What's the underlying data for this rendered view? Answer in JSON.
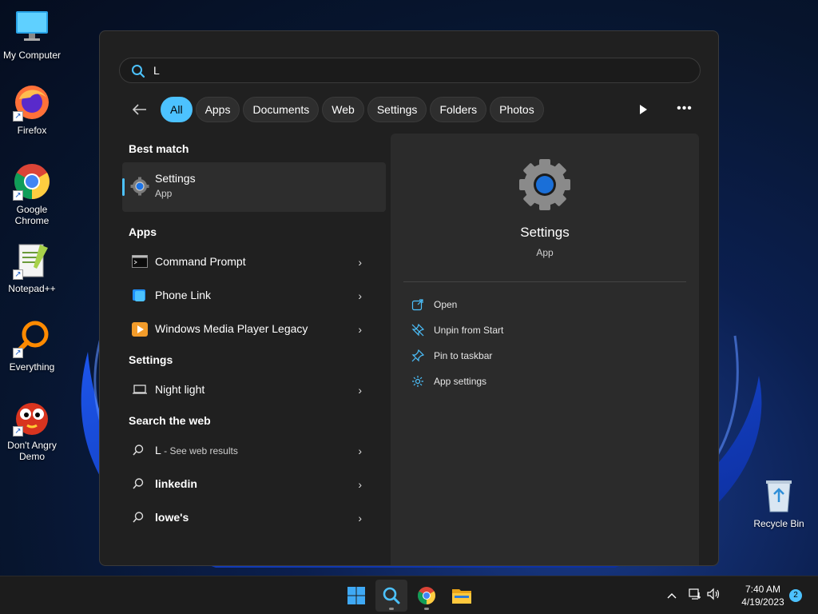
{
  "desktop": {
    "icons": [
      {
        "label": "My Computer",
        "icon": "monitor-icon"
      },
      {
        "label": "Firefox",
        "icon": "firefox-icon"
      },
      {
        "label": "Google Chrome",
        "icon": "chrome-icon"
      },
      {
        "label": "Notepad++",
        "icon": "notepadpp-icon"
      },
      {
        "label": "Everything",
        "icon": "everything-icon"
      },
      {
        "label": "Don't Angry Demo",
        "icon": "dont-angry-icon"
      },
      {
        "label": "Recycle Bin",
        "icon": "recycle-bin-icon"
      }
    ]
  },
  "search": {
    "query": "L",
    "filters": [
      "All",
      "Apps",
      "Documents",
      "Web",
      "Settings",
      "Folders",
      "Photos"
    ],
    "active_filter": "All"
  },
  "results": {
    "best_match_heading": "Best match",
    "best_match": {
      "title": "Settings",
      "subtitle": "App"
    },
    "apps_heading": "Apps",
    "apps": [
      {
        "label": "Command Prompt",
        "icon": "command-prompt-icon"
      },
      {
        "label": "Phone Link",
        "icon": "phone-link-icon"
      },
      {
        "label": "Windows Media Player Legacy",
        "icon": "media-player-icon"
      }
    ],
    "settings_heading": "Settings",
    "settings": [
      {
        "label": "Night light",
        "icon": "laptop-icon"
      }
    ],
    "web_heading": "Search the web",
    "web": [
      {
        "label": "L",
        "suffix": " - See web results"
      },
      {
        "label": "linkedin",
        "suffix": ""
      },
      {
        "label": "lowe's",
        "suffix": ""
      }
    ]
  },
  "preview": {
    "name": "Settings",
    "kind": "App",
    "actions": [
      {
        "label": "Open",
        "icon": "open-icon"
      },
      {
        "label": "Unpin from Start",
        "icon": "unpin-icon"
      },
      {
        "label": "Pin to taskbar",
        "icon": "pin-icon"
      },
      {
        "label": "App settings",
        "icon": "gear-icon"
      }
    ]
  },
  "taskbar": {
    "apps": [
      "start-icon",
      "search-icon",
      "chrome-icon",
      "file-explorer-icon"
    ],
    "time": "7:40 AM",
    "date": "4/19/2023",
    "notification_count": "2"
  },
  "colors": {
    "accent": "#4cc2ff",
    "panel": "#202020",
    "preview": "#2b2b2b"
  }
}
